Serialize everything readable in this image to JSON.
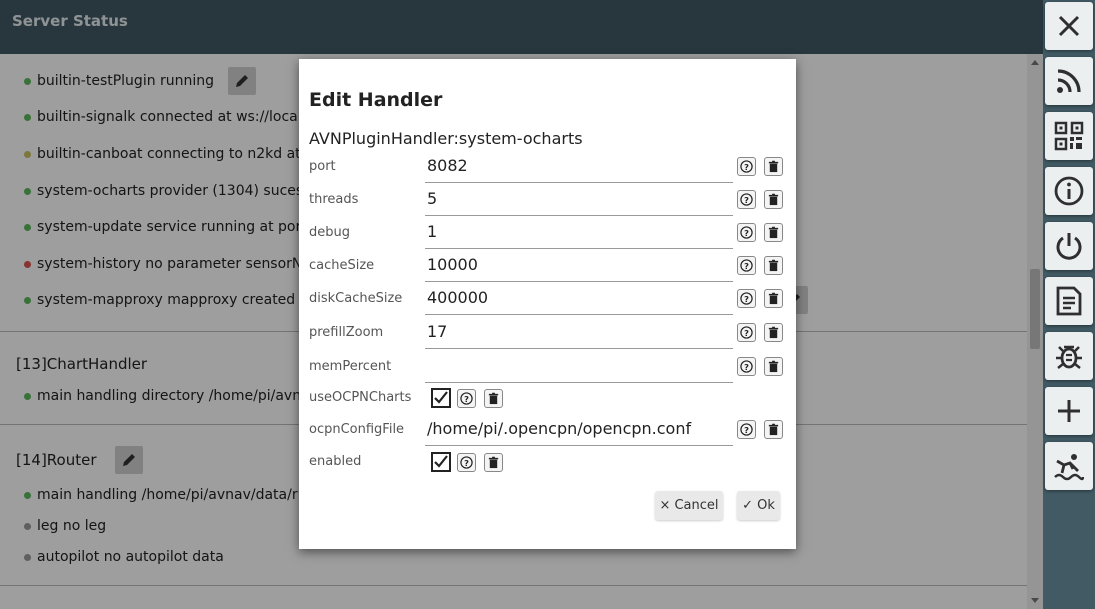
{
  "header": {
    "title": "Server Status"
  },
  "status_rows": [
    {
      "status": "green",
      "name": "builtin-testPlugin",
      "text": "running"
    },
    {
      "status": "green",
      "name": "builtin-signalk",
      "text": "connected at ws://loca"
    },
    {
      "status": "yellow",
      "name": "builtin-canboat",
      "text": "connecting to n2kd at"
    },
    {
      "status": "green",
      "name": "system-ocharts",
      "text": "provider (1304) suces"
    },
    {
      "status": "green",
      "name": "system-update",
      "text": "service running at por"
    },
    {
      "status": "red",
      "name": "system-history",
      "text": "no parameter sensorN"
    },
    {
      "status": "green",
      "name": "system-mapproxy",
      "text": "mapproxy created"
    }
  ],
  "chart_handler": {
    "title": "[13]ChartHandler",
    "rows": [
      {
        "status": "green",
        "name": "main",
        "text": "handling directory /home/pi/avn"
      }
    ]
  },
  "router": {
    "title": "[14]Router",
    "rows": [
      {
        "status": "green",
        "name": "main",
        "text": "handling /home/pi/avnav/data/r"
      },
      {
        "status": "grey",
        "name": "leg",
        "text": "no leg"
      },
      {
        "status": "grey",
        "name": "autopilot",
        "text": "no autopilot data"
      }
    ]
  },
  "dialog": {
    "title": "Edit Handler",
    "subtitle": "AVNPluginHandler:system-ocharts",
    "params": [
      {
        "label": "port",
        "value": "8082"
      },
      {
        "label": "threads",
        "value": "5"
      },
      {
        "label": "debug",
        "value": "1"
      },
      {
        "label": "cacheSize",
        "value": "10000"
      },
      {
        "label": "diskCacheSize",
        "value": "400000"
      },
      {
        "label": "prefillZoom",
        "value": "17"
      },
      {
        "label": "memPercent",
        "value": ""
      }
    ],
    "use_ocpn_charts": {
      "label": "useOCPNCharts",
      "checked": true
    },
    "ocpn_config": {
      "label": "ocpnConfigFile",
      "value": "/home/pi/.opencpn/opencpn.conf"
    },
    "enabled": {
      "label": "enabled",
      "checked": true
    },
    "cancel_label": "× Cancel",
    "ok_label": "✓ Ok"
  },
  "icons": {
    "right_bar": [
      "close-icon",
      "rss-icon",
      "qr-code-icon",
      "info-icon",
      "power-icon",
      "log-icon",
      "debug-bug-icon",
      "add-icon",
      "anchor-watch-icon"
    ]
  }
}
